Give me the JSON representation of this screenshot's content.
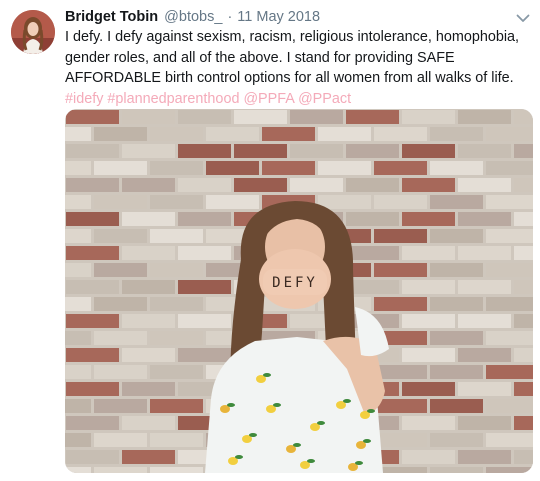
{
  "tweet": {
    "author_name": "Bridget Tobin",
    "author_handle": "@btobs_",
    "separator": "·",
    "date": "11 May 2018",
    "text_main": "I defy. I defy against sexism, racism, religious intolerance, homophobia, gender roles, and all of the above. I stand for providing SAFE AFFORDABLE birth control options for all women from all walks of life. ",
    "hashtags": [
      "#idefy",
      "#plannedparenthood"
    ],
    "mentions": [
      "@PPFA",
      "@PPact"
    ],
    "photo_knuckle_text": "DEFY"
  },
  "icons": {
    "menu": "chevron-down-icon",
    "avatar": "avatar"
  },
  "colors": {
    "link": "#f4aab9",
    "secondary_text": "#657786",
    "primary_text": "#14171a"
  }
}
